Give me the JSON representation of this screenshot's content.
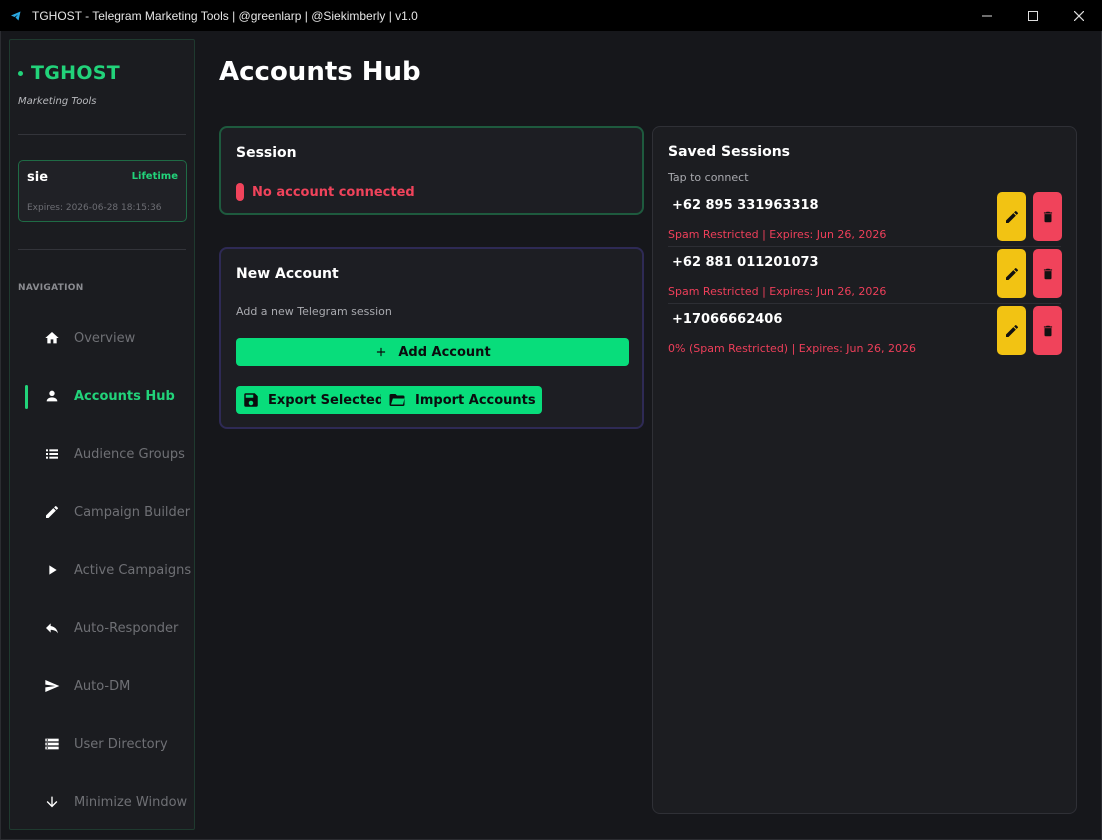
{
  "window": {
    "title": "TGHOST - Telegram Marketing Tools | @greenlarp | @Siekimberly | v1.0"
  },
  "sidebar": {
    "brand": "TGHOST",
    "subtitle": "Marketing Tools",
    "user": {
      "name": "sie",
      "plan": "Lifetime",
      "expires": "Expires: 2026-06-28 18:15:36"
    },
    "nav_heading": "NAVIGATION",
    "items": [
      {
        "label": "Overview",
        "icon": "home-icon",
        "active": false
      },
      {
        "label": "Accounts Hub",
        "icon": "person-icon",
        "active": true
      },
      {
        "label": "Audience Groups",
        "icon": "list-icon",
        "active": false
      },
      {
        "label": "Campaign Builder",
        "icon": "pencil-icon",
        "active": false
      },
      {
        "label": "Active Campaigns",
        "icon": "play-icon",
        "active": false
      },
      {
        "label": "Auto-Responder",
        "icon": "reply-icon",
        "active": false
      },
      {
        "label": "Auto-DM",
        "icon": "send-icon",
        "active": false
      },
      {
        "label": "User Directory",
        "icon": "storage-icon",
        "active": false
      },
      {
        "label": "Minimize Window",
        "icon": "arrow-down-icon",
        "active": false
      }
    ]
  },
  "main": {
    "title": "Accounts Hub",
    "session": {
      "heading": "Session",
      "status": "No account connected"
    },
    "new_account": {
      "heading": "New Account",
      "subtitle": "Add a new Telegram session",
      "add_label": "Add Account",
      "export_label": "Export Selected",
      "import_label": "Import Accounts"
    },
    "saved": {
      "heading": "Saved Sessions",
      "hint": "Tap to connect",
      "sessions": [
        {
          "phone": "+62 895 331963318",
          "meta": "Spam Restricted | Expires: Jun 26, 2026"
        },
        {
          "phone": "+62 881 011201073",
          "meta": "Spam Restricted | Expires: Jun 26, 2026"
        },
        {
          "phone": "+17066662406",
          "meta": "0% (Spam Restricted) | Expires: Jun 26, 2026"
        }
      ]
    }
  },
  "colors": {
    "accent": "#22d37a",
    "button": "#08dd7b",
    "danger": "#f0435b",
    "warning": "#f2c313"
  }
}
